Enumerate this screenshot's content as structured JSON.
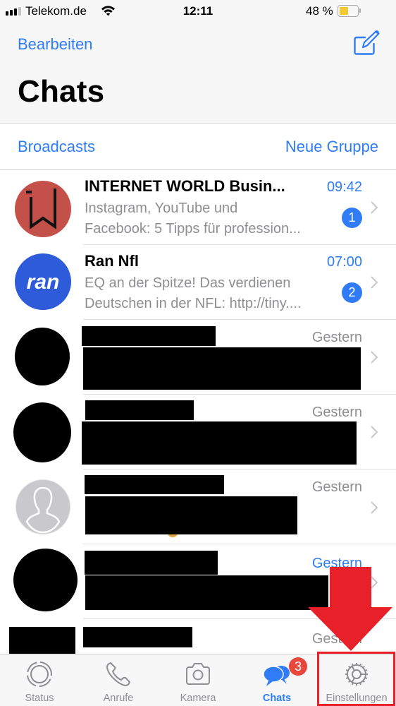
{
  "status_bar": {
    "carrier": "Telekom.de",
    "time": "12:11",
    "battery_label": "48 %",
    "battery_level": 0.48,
    "signal_bars_filled": 3,
    "signal_bars_total": 4,
    "icons": [
      "signal-icon",
      "wifi-icon",
      "battery-icon"
    ]
  },
  "nav": {
    "edit_label": "Bearbeiten",
    "compose_icon": "compose-icon",
    "title": "Chats"
  },
  "actions": {
    "broadcasts_label": "Broadcasts",
    "new_group_label": "Neue Gruppe"
  },
  "chats": [
    {
      "name": "INTERNET WORLD Busin...",
      "time": "09:42",
      "unread_time": true,
      "message_line1": "Instagram, YouTube und",
      "message_line2": "Facebook: 5 Tipps für profession...",
      "unread_count": "1",
      "avatar": "internet-world-logo"
    },
    {
      "name": "Ran Nfl",
      "time": "07:00",
      "unread_time": true,
      "message_line1": "EQ an der Spitze! Das verdienen",
      "message_line2": "Deutschen in der NFL: http://tiny....",
      "unread_count": "2",
      "avatar": "ran-logo",
      "avatar_text": "ran"
    },
    {
      "redacted": true,
      "time": "Gestern",
      "unread_time": false,
      "avatar": "redacted"
    },
    {
      "redacted": true,
      "time": "Gestern",
      "unread_time": false,
      "avatar": "redacted"
    },
    {
      "redacted": true,
      "time": "Gestern",
      "unread_time": false,
      "avatar": "default-person"
    },
    {
      "redacted": true,
      "time": "Gestern",
      "unread_time": true,
      "avatar": "redacted"
    },
    {
      "redacted": true,
      "time": "Gestern",
      "unread_time": false,
      "avatar": "redacted"
    }
  ],
  "tabbar": {
    "tabs": [
      {
        "label": "Status",
        "icon": "status-icon",
        "active": false
      },
      {
        "label": "Anrufe",
        "icon": "phone-icon",
        "active": false
      },
      {
        "label": "Kamera",
        "icon": "camera-icon",
        "active": false
      },
      {
        "label": "Chats",
        "icon": "chats-icon",
        "active": true,
        "badge": "3"
      },
      {
        "label": "Einstellungen",
        "icon": "gear-icon",
        "active": false
      }
    ]
  },
  "annotation": {
    "type": "arrow-and-box",
    "target": "Einstellungen",
    "color": "#e8202a"
  },
  "colors": {
    "accent": "#2f7cf6",
    "secondary_text": "#8e8e93",
    "badge_red": "#e8483c",
    "bar_background": "#f7f7f7"
  }
}
